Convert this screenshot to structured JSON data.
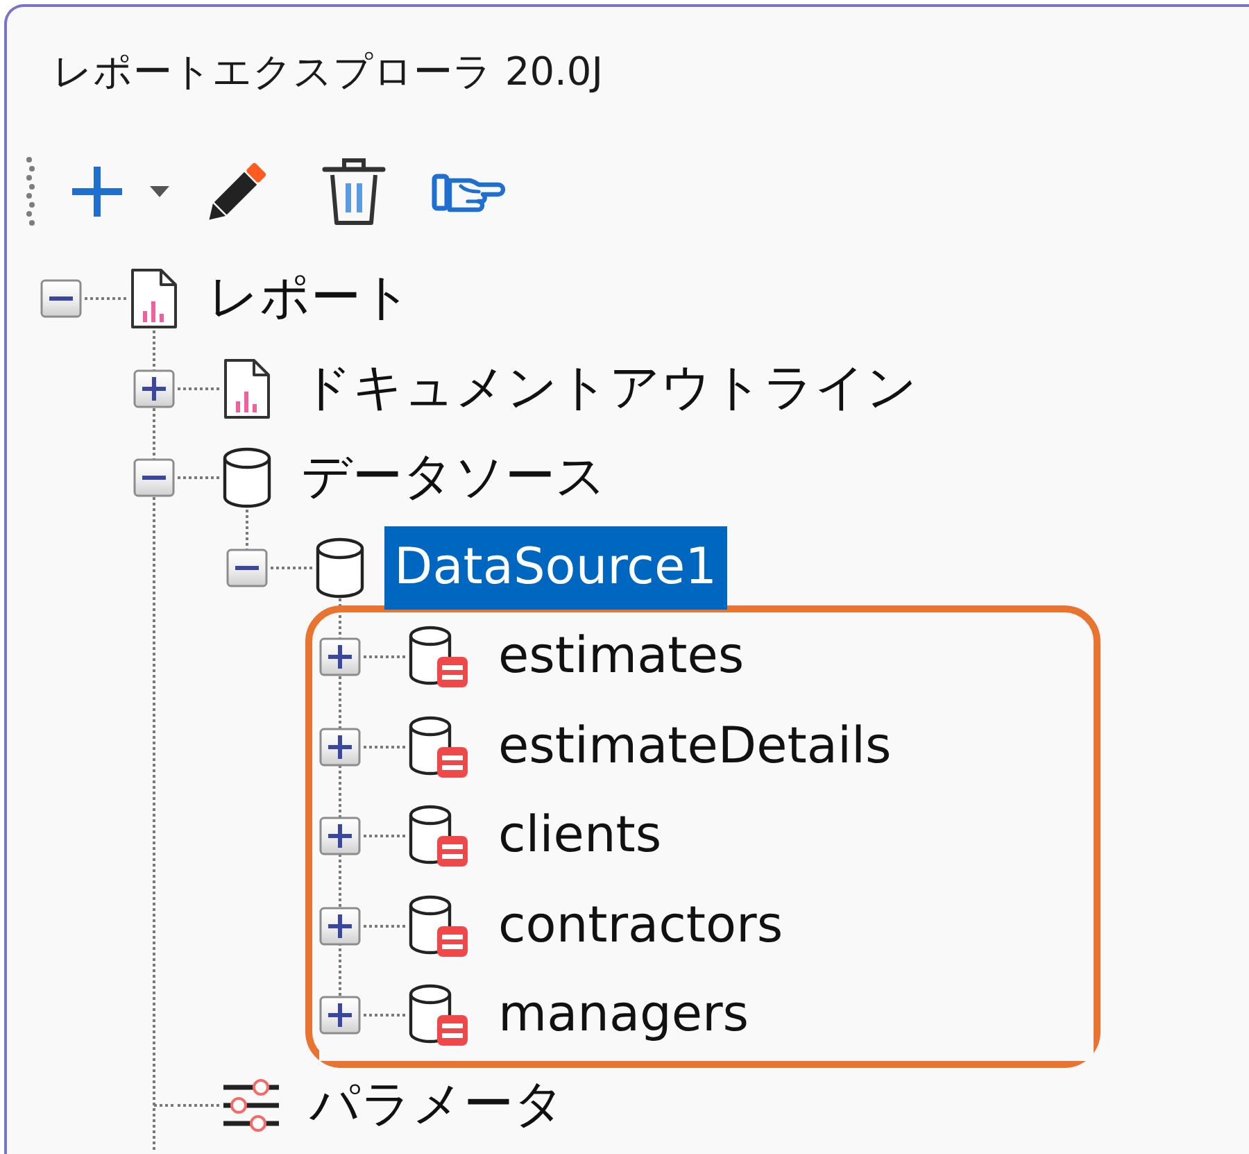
{
  "window": {
    "title": "レポートエクスプローラ 20.0J"
  },
  "toolbar": {
    "items": [
      {
        "kind": "add",
        "dropdown": true
      },
      {
        "kind": "edit"
      },
      {
        "kind": "delete"
      },
      {
        "kind": "hand"
      }
    ]
  },
  "tree": {
    "items": [
      {
        "label": "レポート",
        "kind": "report",
        "expandable": true,
        "expanded": true,
        "selected": false,
        "children": [
          {
            "label": "ドキュメントアウトライン",
            "kind": "report",
            "expandable": true,
            "expanded": false,
            "selected": false
          },
          {
            "label": "データソース",
            "kind": "datasource",
            "expandable": true,
            "expanded": true,
            "selected": false,
            "children": [
              {
                "label": "DataSource1",
                "kind": "datasource",
                "expandable": true,
                "expanded": true,
                "selected": true,
                "children_framed": true,
                "children": [
                  {
                    "label": "estimates",
                    "kind": "table",
                    "expandable": true,
                    "expanded": false,
                    "selected": false
                  },
                  {
                    "label": "estimateDetails",
                    "kind": "table",
                    "expandable": true,
                    "expanded": false,
                    "selected": false
                  },
                  {
                    "label": "clients",
                    "kind": "table",
                    "expandable": true,
                    "expanded": false,
                    "selected": false
                  },
                  {
                    "label": "contractors",
                    "kind": "table",
                    "expandable": true,
                    "expanded": false,
                    "selected": false
                  },
                  {
                    "label": "managers",
                    "kind": "table",
                    "expandable": true,
                    "expanded": false,
                    "selected": false
                  }
                ]
              }
            ]
          },
          {
            "label": "パラメータ",
            "kind": "parameters",
            "expandable": false,
            "selected": false
          }
        ]
      }
    ]
  }
}
